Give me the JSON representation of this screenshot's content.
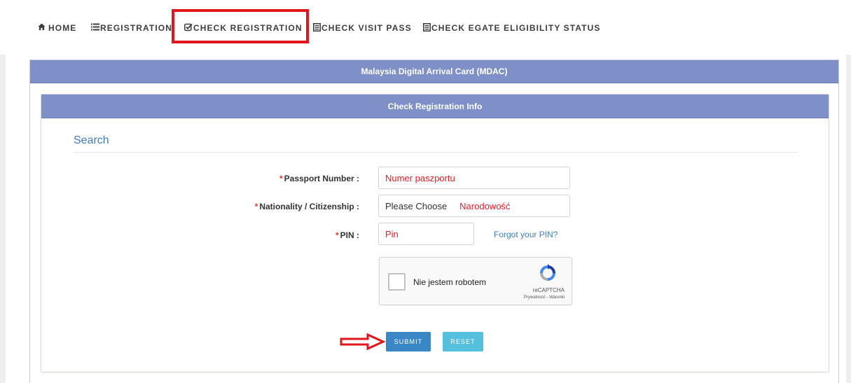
{
  "nav": {
    "items": [
      {
        "icon": "home-icon",
        "label": "HOME"
      },
      {
        "icon": "list-icon",
        "label": "REGISTRATION"
      },
      {
        "icon": "check-square-icon",
        "label": "CHECK REGISTRATION"
      },
      {
        "icon": "document-icon",
        "label": "CHECK VISIT PASS"
      },
      {
        "icon": "document-icon",
        "label": "CHECK EGATE ELIGIBILITY STATUS"
      }
    ]
  },
  "colors": {
    "panel_header": "#7f90c9",
    "highlight": "#e1151b",
    "link": "#3e7fbf",
    "submit": "#3a87c6",
    "reset": "#55c0de",
    "annotation_text": "#e01e25"
  },
  "outer_panel": {
    "title": "Malaysia Digital Arrival Card (MDAC)"
  },
  "inner_panel": {
    "title": "Check Registration Info"
  },
  "search": {
    "title": "Search"
  },
  "form": {
    "required_mark": "*",
    "passport_label": "Passport Number :",
    "passport_value": "Numer paszportu",
    "nationality_label": "Nationality / Citizenship :",
    "nationality_value": "Please Choose",
    "nationality_hint": "Narodowość",
    "pin_label": "PIN :",
    "pin_value": "Pin",
    "forgot_pin": "Forgot your PIN?"
  },
  "captcha": {
    "label": "Nie jestem robotem",
    "brand": "reCAPTCHA",
    "links": "Prywatność - Warunki"
  },
  "buttons": {
    "submit": "SUBMIT",
    "reset": "RESET"
  }
}
